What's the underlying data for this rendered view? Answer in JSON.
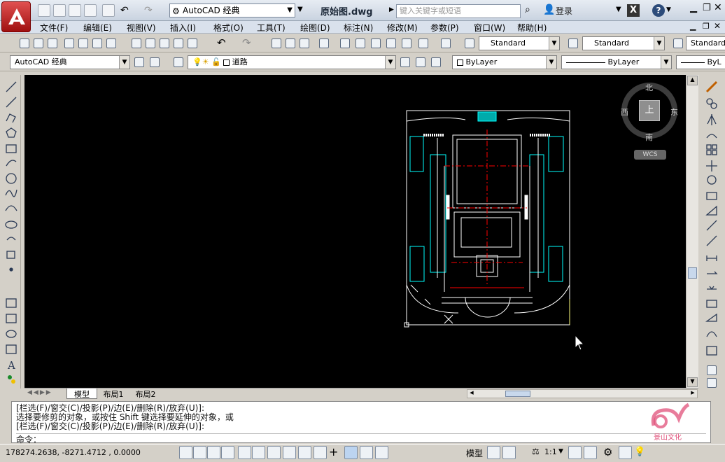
{
  "title_bar": {
    "workspace": "AutoCAD 经典",
    "document_title": "原始图.dwg",
    "search_placeholder": "键入关键字或短语",
    "login_label": "登录"
  },
  "menu": [
    "文件(F)",
    "编辑(E)",
    "视图(V)",
    "插入(I)",
    "格式(O)",
    "工具(T)",
    "绘图(D)",
    "标注(N)",
    "修改(M)",
    "参数(P)",
    "窗口(W)",
    "帮助(H)"
  ],
  "toolbar_styles": {
    "text_style": "Standard",
    "dim_style": "Standard",
    "table_style": "Standard"
  },
  "layers_toolbar": {
    "workspace_combo": "AutoCAD 经典",
    "current_layer": "道路",
    "color": "ByLayer",
    "linetype": "ByLayer",
    "lineweight": "ByL"
  },
  "viewcube": {
    "north": "北",
    "south": "南",
    "east": "东",
    "west": "西",
    "face": "上",
    "ucs": "WCS"
  },
  "layout_tabs": [
    "模型",
    "布局1",
    "布局2"
  ],
  "command_history": [
    "[栏选(F)/窗交(C)/投影(P)/边(E)/删除(R)/放弃(U)]:",
    "选择要修剪的对象，或按住 Shift 键选择要延伸的对象，或",
    "[栏选(F)/窗交(C)/投影(P)/边(E)/删除(R)/放弃(U)]:"
  ],
  "command_prompt": "命令：",
  "status": {
    "coordinates": "178274.2638, -8271.4712 , 0.0000",
    "model_label": "模型",
    "scale": "1:1"
  },
  "logo_text": "景山文化",
  "colors": {
    "canvas": "#000000",
    "cyan": "#00ffff",
    "red": "#ff0000",
    "white": "#ffffff",
    "yellow": "#ffff80"
  }
}
